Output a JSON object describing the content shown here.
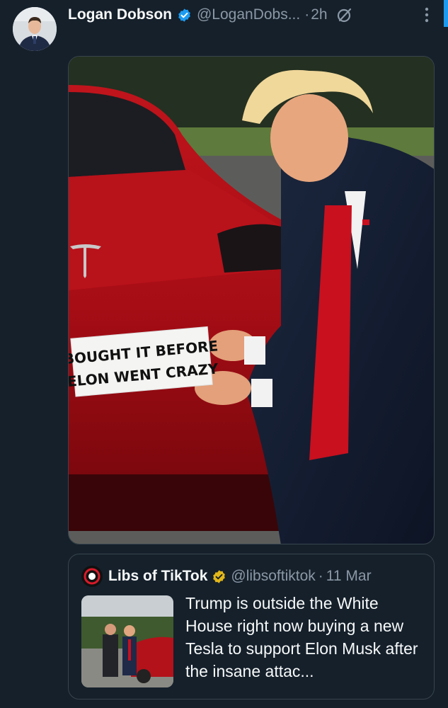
{
  "tweet": {
    "author_name": "Logan Dobson",
    "author_handle": "@LoganDobs...",
    "dot": "·",
    "time": "2h",
    "avatar_icon": "avatar-photo",
    "verified_icon": "verified-badge-icon",
    "menu_icon": "more-vertical-icon",
    "grok_icon": "grok-icon"
  },
  "image": {
    "sticker_line1": "BOUGHT IT BEFORE",
    "sticker_line2": "ELON WENT CRAZY"
  },
  "quote": {
    "author_name": "Libs of TikTok",
    "author_handle": "@libsoftiktok",
    "dot": "·",
    "date": "11 Mar",
    "avatar_label": "Libs of TikTok",
    "text": "Trump is outside the White House right now buying a new Tesla to support Elon Musk after the insane attac..."
  },
  "colors": {
    "background": "#15202b",
    "accent": "#1d9bf0",
    "verified_blue": "#1d9bf0",
    "verified_gold": "#e2b719",
    "secondary_text": "#8b98a5",
    "border": "#38444d"
  }
}
